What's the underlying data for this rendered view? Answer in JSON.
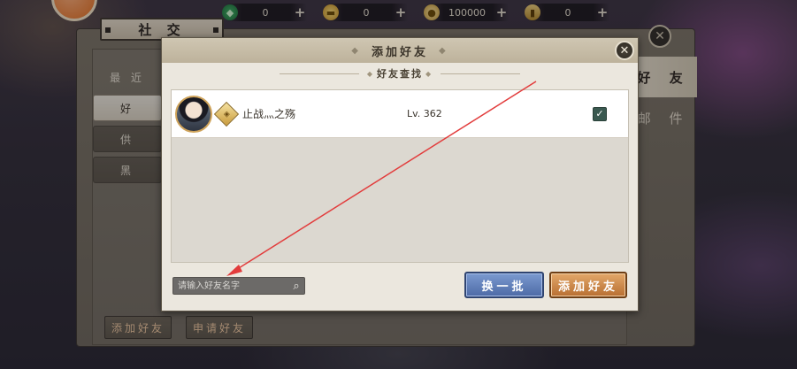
{
  "resources": [
    {
      "icon": "jade-icon",
      "value": "0"
    },
    {
      "icon": "gold-ingot-icon",
      "value": "0"
    },
    {
      "icon": "coin-icon",
      "value": "100000"
    },
    {
      "icon": "scroll-icon",
      "value": "0"
    }
  ],
  "social": {
    "title": "社 交",
    "left_tabs": [
      "最 近",
      "好",
      "供",
      "黑"
    ],
    "right_tabs": [
      "好 友",
      "邮 件"
    ],
    "bottom_buttons": [
      "添加好友",
      "申请好友"
    ]
  },
  "dialog": {
    "title": "添加好友",
    "subtitle": "好友查找",
    "friend": {
      "name": "止战灬之殇",
      "level": "Lv. 362",
      "checked": true
    },
    "search_placeholder": "请输入好友名字",
    "refresh_button": "换一批",
    "add_button": "添加好友"
  },
  "colors": {
    "refresh_button": "#5b78b4",
    "add_button": "#c98344",
    "annotation_arrow": "#e23c3c"
  }
}
